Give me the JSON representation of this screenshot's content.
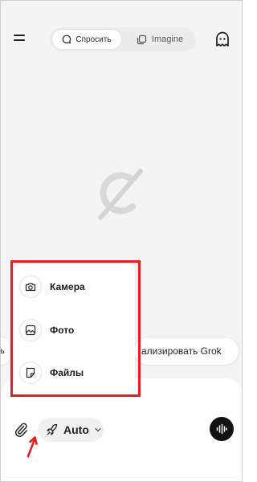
{
  "header": {
    "mode_ask_label": "Спросить",
    "mode_imagine_label": "Imagine"
  },
  "suggestions": {
    "left_fragment": "ь",
    "right_label": "ализировать Grok"
  },
  "attach_menu": {
    "items": [
      {
        "label": "Камера",
        "icon": "camera-icon"
      },
      {
        "label": "Фото",
        "icon": "photo-icon"
      },
      {
        "label": "Файлы",
        "icon": "file-icon"
      }
    ]
  },
  "toolbar": {
    "model_label": "Auto"
  },
  "colors": {
    "highlight": "#e02020",
    "voice_button": "#111111"
  }
}
